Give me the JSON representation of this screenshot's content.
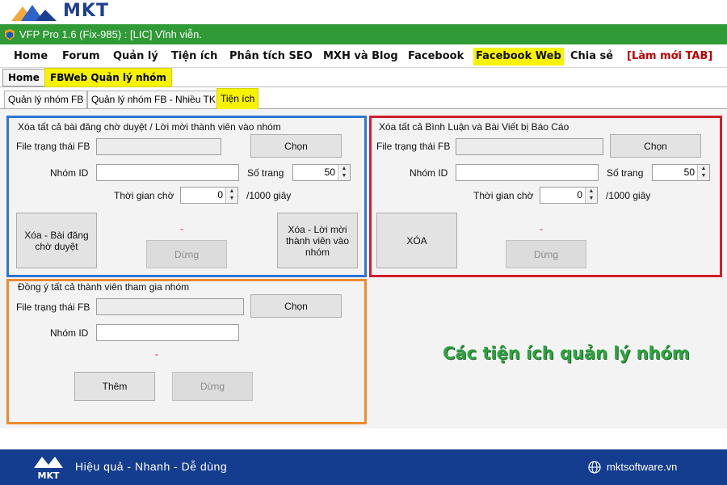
{
  "brand": {
    "name": "MKT"
  },
  "window": {
    "title": "VFP Pro 1.6 (Fix-985) : [LIC] Vĩnh viễn."
  },
  "menu": [
    {
      "label": "Home",
      "highlight": false,
      "color": ""
    },
    {
      "label": "Forum",
      "highlight": false,
      "color": ""
    },
    {
      "label": "Quản lý",
      "highlight": false,
      "color": ""
    },
    {
      "label": "Tiện ích",
      "highlight": false,
      "color": ""
    },
    {
      "label": "Phân tích SEO",
      "highlight": false,
      "color": ""
    },
    {
      "label": "MXH và Blog",
      "highlight": false,
      "color": ""
    },
    {
      "label": "Facebook",
      "highlight": false,
      "color": ""
    },
    {
      "label": "Facebook Web",
      "highlight": true,
      "color": ""
    },
    {
      "label": "Chia sẻ",
      "highlight": false,
      "color": ""
    },
    {
      "label": "[Làm mới TAB]",
      "highlight": false,
      "color": "#b80000"
    }
  ],
  "subtabs": {
    "home": "Home",
    "active": "FBWeb Quản lý nhóm"
  },
  "innertabs": [
    {
      "label": "Quản lý nhóm FB",
      "active": false
    },
    {
      "label": "Quản lý nhóm FB - Nhiều TK",
      "active": false
    },
    {
      "label": "Tiện ích",
      "active": true
    }
  ],
  "panel_left": {
    "title": "Xóa tất cả bài đăng chờ duyệt / Lời mời thành viên vào nhóm",
    "file_label": "File trạng thái FB",
    "file_value": "",
    "choose_button": "Chọn",
    "group_id_label": "Nhóm ID",
    "group_id_value": "",
    "pages_label": "Số trang",
    "pages_value": "50",
    "wait_label": "Thời gian chờ",
    "wait_value": "0",
    "wait_unit": "/1000 giây",
    "status": "-",
    "delete_posts_button": "Xóa - Bài đăng chờ duyệt",
    "stop_button": "Dừng",
    "delete_invites_button": "Xóa - Lời mời thành viên vào nhóm"
  },
  "panel_right": {
    "title": "Xóa tất cả Bình Luận và Bài Viết bị Báo Cáo",
    "file_label": "File trạng thái FB",
    "file_value": "",
    "choose_button": "Chọn",
    "group_id_label": "Nhóm ID",
    "group_id_value": "",
    "pages_label": "Số trang",
    "pages_value": "50",
    "wait_label": "Thời gian chờ",
    "wait_value": "0",
    "wait_unit": "/1000 giây",
    "status": "-",
    "delete_button": "XÓA",
    "stop_button": "Dừng"
  },
  "panel_bottom": {
    "title": "Đồng ý tất cả thành viên tham gia nhóm",
    "file_label": "File trạng thái FB",
    "file_value": "",
    "choose_button": "Chọn",
    "group_id_label": "Nhóm ID",
    "group_id_value": "",
    "status": "-",
    "add_button": "Thêm",
    "stop_button": "Dừng"
  },
  "caption": "Các tiện ích quản lý nhóm",
  "footer": {
    "slogan": "Hiệu quả - Nhanh - Dễ dùng",
    "website": "mktsoftware.vn"
  },
  "colors": {
    "titlebar": "#2f9a36",
    "highlight": "#f6f200",
    "frame_blue": "#2a76d6",
    "frame_red": "#cf1f2a",
    "frame_orange": "#ec8c2e",
    "footer": "#143d8f",
    "caption": "#2fa341"
  }
}
